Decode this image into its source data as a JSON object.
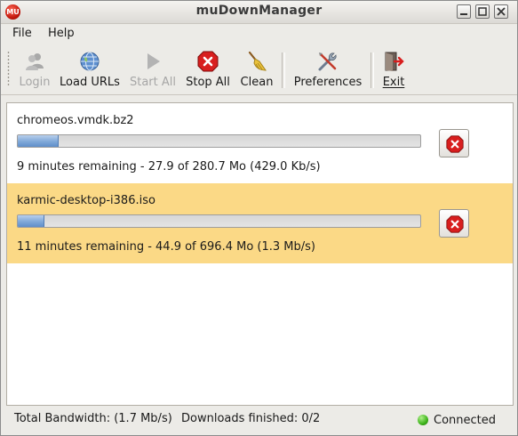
{
  "window": {
    "title": "muDownManager",
    "icon_text": "MU"
  },
  "menu": {
    "items": [
      "File",
      "Help"
    ]
  },
  "toolbar": {
    "login_label": "Login",
    "load_urls_label": "Load URLs",
    "start_all_label": "Start All",
    "stop_all_label": "Stop All",
    "clean_label": "Clean",
    "preferences_label": "Preferences",
    "exit_label": "Exit"
  },
  "downloads": [
    {
      "filename": "chromeos.vmdk.bz2",
      "progress_fraction": 0.099,
      "status": "9 minutes remaining - 27.9 of 280.7 Mo (429.0 Kb/s)",
      "selected": false
    },
    {
      "filename": "karmic-desktop-i386.iso",
      "progress_fraction": 0.064,
      "status": "11 minutes remaining - 44.9 of 696.4 Mo (1.3 Mb/s)",
      "selected": true
    }
  ],
  "statusbar": {
    "bandwidth": "Total Bandwidth: (1.7 Mb/s)",
    "finished": "Downloads finished: 0/2",
    "connection": "Connected"
  },
  "colors": {
    "selected_row": "#fbd986",
    "progress_fill": "#7fa8d8",
    "stop_red": "#d81e1e",
    "connected_green": "#3db31a"
  }
}
